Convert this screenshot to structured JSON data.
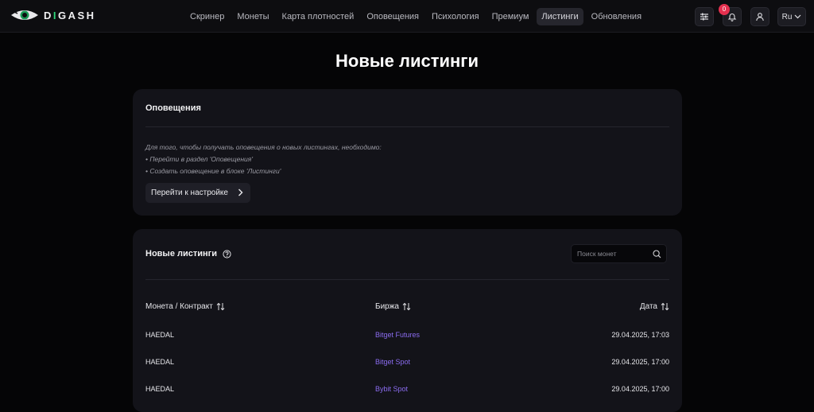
{
  "header": {
    "logo_text_prefix": "D",
    "logo_text_i": "I",
    "logo_text_suffix": "GASH",
    "nav": [
      {
        "label": "Скринер"
      },
      {
        "label": "Монеты"
      },
      {
        "label": "Карта плотностей"
      },
      {
        "label": "Оповещения"
      },
      {
        "label": "Психология"
      },
      {
        "label": "Премиум"
      },
      {
        "label": "Листинги",
        "active": true
      },
      {
        "label": "Обновления"
      }
    ],
    "notification_count": "0",
    "language": "Ru"
  },
  "page": {
    "title": "Новые листинги"
  },
  "alerts_card": {
    "title": "Оповещения",
    "notice_line1": "Для того, чтобы получать оповещения о новых листингах, необходимо:",
    "notice_line2": "• Перейти в раздел 'Оповещения'",
    "notice_line3": "• Создать оповещение в блоке 'Листинги'",
    "button_label": "Перейти к настройке"
  },
  "listings_card": {
    "title": "Новые листинги",
    "search_placeholder": "Поиск монет",
    "columns": {
      "coin": "Монета / Контракт",
      "exchange": "Биржа",
      "date": "Дата"
    },
    "rows": [
      {
        "coin": "HAEDAL",
        "exchange": "Bitget Futures",
        "date": "29.04.2025, 17:03"
      },
      {
        "coin": "HAEDAL",
        "exchange": "Bitget Spot",
        "date": "29.04.2025, 17:00"
      },
      {
        "coin": "HAEDAL",
        "exchange": "Bybit Spot",
        "date": "29.04.2025, 17:00"
      }
    ]
  },
  "colors": {
    "background": "#050506",
    "card": "#131319",
    "accent_link": "#8b6cf0",
    "badge": "#e5304f",
    "logo_accent": "#2ed47a"
  }
}
